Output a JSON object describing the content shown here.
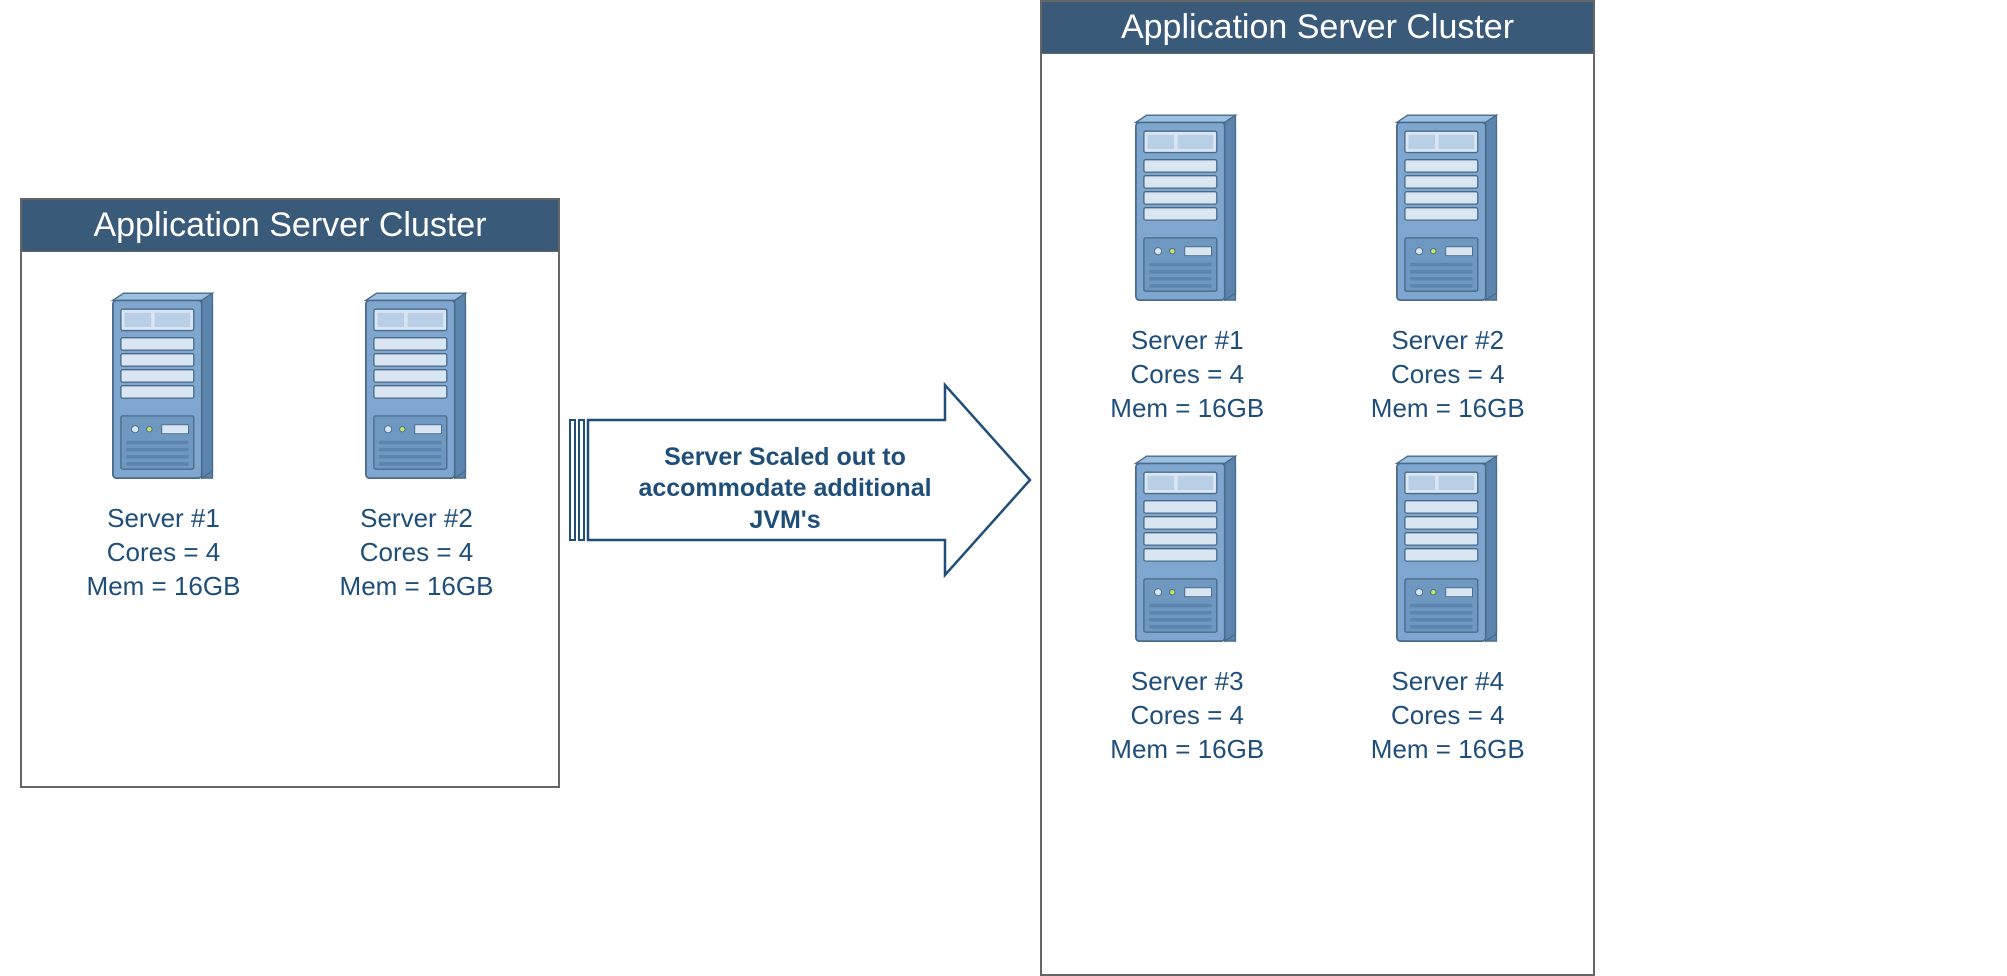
{
  "clusters": {
    "left": {
      "title": "Application Server Cluster",
      "servers": [
        {
          "name": "Server #1",
          "cores": "Cores = 4",
          "mem": "Mem = 16GB"
        },
        {
          "name": "Server #2",
          "cores": "Cores = 4",
          "mem": "Mem = 16GB"
        }
      ]
    },
    "right": {
      "title": "Application Server Cluster",
      "servers": [
        {
          "name": "Server #1",
          "cores": "Cores = 4",
          "mem": "Mem = 16GB"
        },
        {
          "name": "Server #2",
          "cores": "Cores = 4",
          "mem": "Mem = 16GB"
        },
        {
          "name": "Server #3",
          "cores": "Cores = 4",
          "mem": "Mem = 16GB"
        },
        {
          "name": "Server #4",
          "cores": "Cores = 4",
          "mem": "Mem = 16GB"
        }
      ]
    }
  },
  "arrow": {
    "label": "Server Scaled out to accommodate additional JVM's"
  },
  "colors": {
    "header_bg": "#3a5a7a",
    "text": "#1f4e79",
    "border": "#666666"
  }
}
